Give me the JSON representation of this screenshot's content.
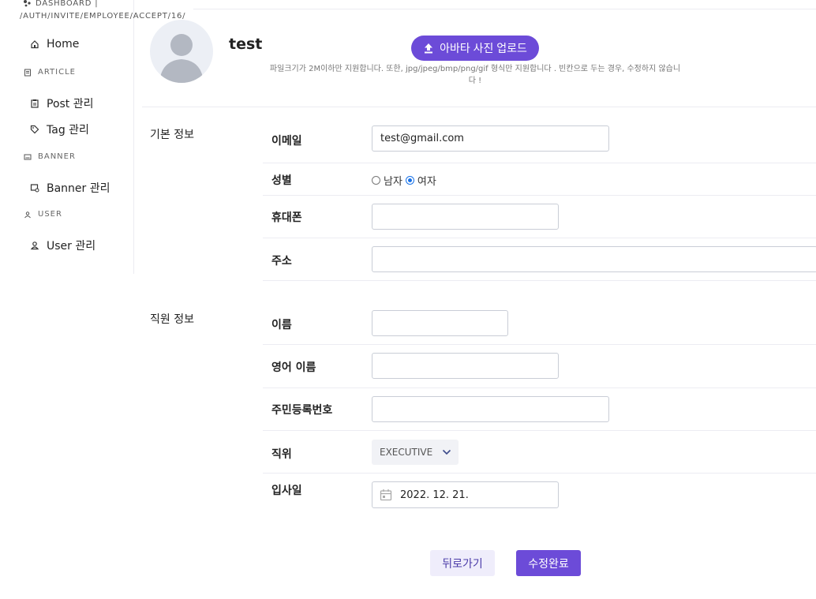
{
  "breadcrumb": {
    "line1": "DASHBOARD |",
    "line2": "/AUTH/INVITE/EMPLOYEE/ACCEPT/16/"
  },
  "sidebar": {
    "home": {
      "label": "Home",
      "icon": "home-icon"
    },
    "sections": [
      {
        "label": "ARTICLE",
        "icon": "article-icon",
        "items": [
          {
            "label": "Post 관리",
            "icon": "clipboard-icon"
          },
          {
            "label": "Tag 관리",
            "icon": "tag-icon"
          }
        ]
      },
      {
        "label": "BANNER",
        "icon": "banner-icon",
        "items": [
          {
            "label": "Banner 관리",
            "icon": "banner-edit-icon"
          }
        ]
      },
      {
        "label": "USER",
        "icon": "users-icon",
        "items": [
          {
            "label": "User 관리",
            "icon": "user-icon"
          }
        ]
      }
    ]
  },
  "profile": {
    "username": "test",
    "upload_button": "아바타 사진 업로드",
    "upload_help": "파일크기가 2M이하만 지원합니다. 또한, jpg/jpeg/bmp/png/gif 형식만 지원합니다 . 빈칸으로 두는 경우, 수정하지 않습니다 !"
  },
  "basic_info": {
    "title": "기본 정보",
    "email": {
      "label": "이메일",
      "value": "test@gmail.com"
    },
    "gender": {
      "label": "성별",
      "options": [
        "남자",
        "여자"
      ],
      "selected": "여자"
    },
    "phone": {
      "label": "휴대폰",
      "value": ""
    },
    "address": {
      "label": "주소",
      "value": ""
    }
  },
  "employee_info": {
    "title": "직원 정보",
    "name": {
      "label": "이름",
      "value": ""
    },
    "english_name": {
      "label": "영어 이름",
      "value": ""
    },
    "resident_number": {
      "label": "주민등록번호",
      "value": ""
    },
    "position": {
      "label": "직위",
      "value": "EXECUTIVE"
    },
    "join_date": {
      "label": "입사일",
      "value": "2022. 12. 21."
    }
  },
  "actions": {
    "back": "뒤로가기",
    "submit": "수정완료"
  },
  "colors": {
    "accent": "#6c4bd8",
    "radio_checked": "#1a73e8",
    "divider": "#ececf2"
  }
}
